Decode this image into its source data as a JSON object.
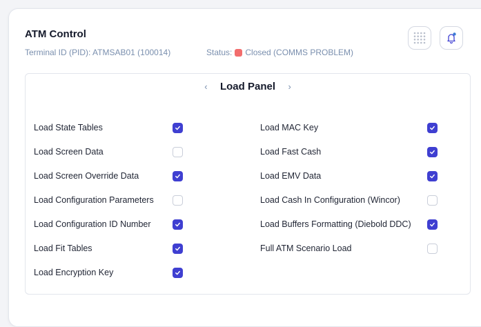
{
  "header": {
    "title": "ATM Control",
    "terminal_id": "Terminal ID (PID): ATMSAB01 (100014)",
    "status_label": "Status:",
    "status_value": "Closed (COMMS PROBLEM)",
    "status_color": "#f26d6d"
  },
  "icons": {
    "grid": "grid-dots-icon",
    "bell": "bell-notification-icon"
  },
  "panel": {
    "title": "Load Panel",
    "prev_arrow": "‹",
    "next_arrow": "›",
    "left_items": [
      {
        "label": "Load State Tables",
        "checked": true
      },
      {
        "label": "Load Screen Data",
        "checked": false
      },
      {
        "label": "Load Screen Override Data",
        "checked": true
      },
      {
        "label": "Load Configuration Parameters",
        "checked": false
      },
      {
        "label": "Load Configuration ID Number",
        "checked": true
      },
      {
        "label": "Load Fit Tables",
        "checked": true
      },
      {
        "label": "Load Encryption Key",
        "checked": true
      }
    ],
    "right_items": [
      {
        "label": "Load MAC Key",
        "checked": true
      },
      {
        "label": "Load Fast Cash",
        "checked": true
      },
      {
        "label": "Load EMV Data",
        "checked": true
      },
      {
        "label": "Load Cash In Configuration (Wincor)",
        "checked": false
      },
      {
        "label": "Load Buffers Formatting (Diebold DDC)",
        "checked": true
      },
      {
        "label": "Full ATM Scenario Load",
        "checked": false
      }
    ]
  },
  "colors": {
    "accent": "#3f3fd1",
    "muted_text": "#7a8fae"
  }
}
